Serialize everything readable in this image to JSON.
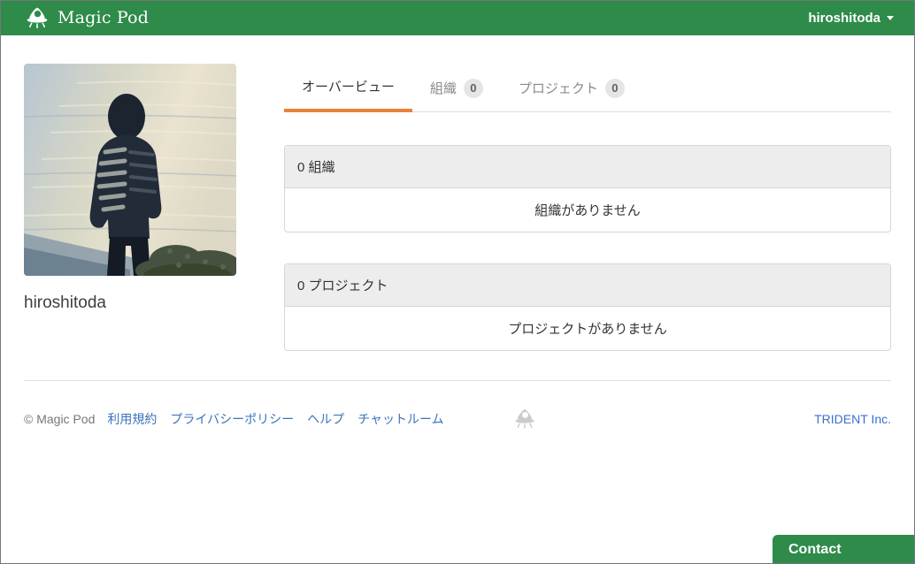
{
  "navbar": {
    "brand": "Magic Pod",
    "username": "hiroshitoda"
  },
  "profile": {
    "username": "hiroshitoda"
  },
  "tabs": {
    "overview": {
      "label": "オーバービュー"
    },
    "organization": {
      "label": "組織",
      "count": "0"
    },
    "project": {
      "label": "プロジェクト",
      "count": "0"
    }
  },
  "panels": {
    "organization": {
      "title": "0 組織",
      "empty": "組織がありません"
    },
    "project": {
      "title": "0 プロジェクト",
      "empty": "プロジェクトがありません"
    }
  },
  "footer": {
    "copyright": "© Magic Pod",
    "links": [
      {
        "label": "利用規約"
      },
      {
        "label": "プライバシーポリシー"
      },
      {
        "label": "ヘルプ"
      },
      {
        "label": "チャットルーム"
      }
    ],
    "company_link": "TRIDENT Inc."
  },
  "contact_button": {
    "label": "Contact"
  },
  "colors": {
    "brand_green": "#2e8b4a",
    "tab_active_underline": "#e8823a",
    "link_blue": "#3b73b9",
    "company_blue": "#3a70cf"
  }
}
